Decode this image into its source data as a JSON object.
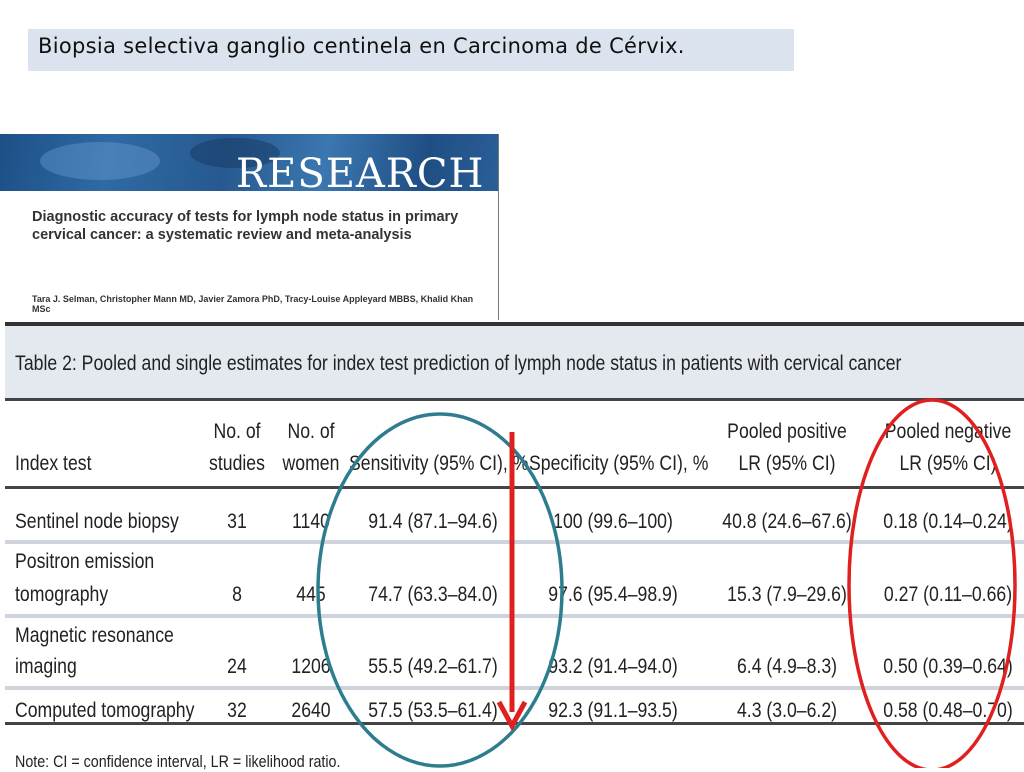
{
  "slide": {
    "title": "Biopsia selectiva ganglio centinela en Carcinoma de Cérvix."
  },
  "article": {
    "journal_word": "RESEARCH",
    "title": "Diagnostic accuracy of tests for lymph node status in primary cervical cancer: a systematic review and meta-analysis",
    "authors": "Tara J. Selman, Christopher Mann MD, Javier Zamora PhD, Tracy-Louise Appleyard MBBS, Khalid Khan MSc"
  },
  "table": {
    "caption": "Table 2: Pooled and single estimates for index test prediction of lymph node status in patients with cervical cancer",
    "headers": {
      "index_test": "Index test",
      "studies_1": "No. of",
      "studies_2": "studies",
      "women_1": "No. of",
      "women_2": "women",
      "sensitivity": "Sensitivity (95% CI), %",
      "specificity": "Specificity (95% CI), %",
      "plr_1": "Pooled positive",
      "plr_2": "LR (95% CI)",
      "nlr_1": "Pooled negative",
      "nlr_2": "LR (95% CI)"
    },
    "rows": [
      {
        "test_1": "Sentinel node biopsy",
        "test_2": "",
        "studies": "31",
        "women": "1140",
        "sensitivity": "91.4 (87.1–94.6)",
        "specificity": "100 (99.6–100)",
        "plr": "40.8 (24.6–67.6)",
        "nlr": "0.18 (0.14–0.24)"
      },
      {
        "test_1": "Positron emission",
        "test_2": "tomography",
        "studies": "8",
        "women": "445",
        "sensitivity": "74.7 (63.3–84.0)",
        "specificity": "97.6 (95.4–98.9)",
        "plr": "15.3   (7.9–29.6)",
        "nlr": "0.27 (0.11–0.66)"
      },
      {
        "test_1": "Magnetic resonance",
        "test_2": "imaging",
        "studies": "24",
        "women": "1206",
        "sensitivity": "55.5 (49.2–61.7)",
        "specificity": "93.2 (91.4–94.0)",
        "plr": "6.4   (4.9–8.3)",
        "nlr": "0.50 (0.39–0.64)"
      },
      {
        "test_1": "Computed tomography",
        "test_2": "",
        "studies": "32",
        "women": "2640",
        "sensitivity": "57.5 (53.5–61.4)",
        "specificity": "92.3 (91.1–93.5)",
        "plr": "4.3   (3.0–6.2)",
        "nlr": "0.58 (0.48–0.70)"
      }
    ],
    "note": "Note: CI = confidence interval, LR = likelihood ratio."
  },
  "annotations": {
    "sensitivity_ellipse_color": "#2e7d8e",
    "negative_lr_ellipse_color": "#e0201f",
    "arrow_color": "#e0201f"
  }
}
